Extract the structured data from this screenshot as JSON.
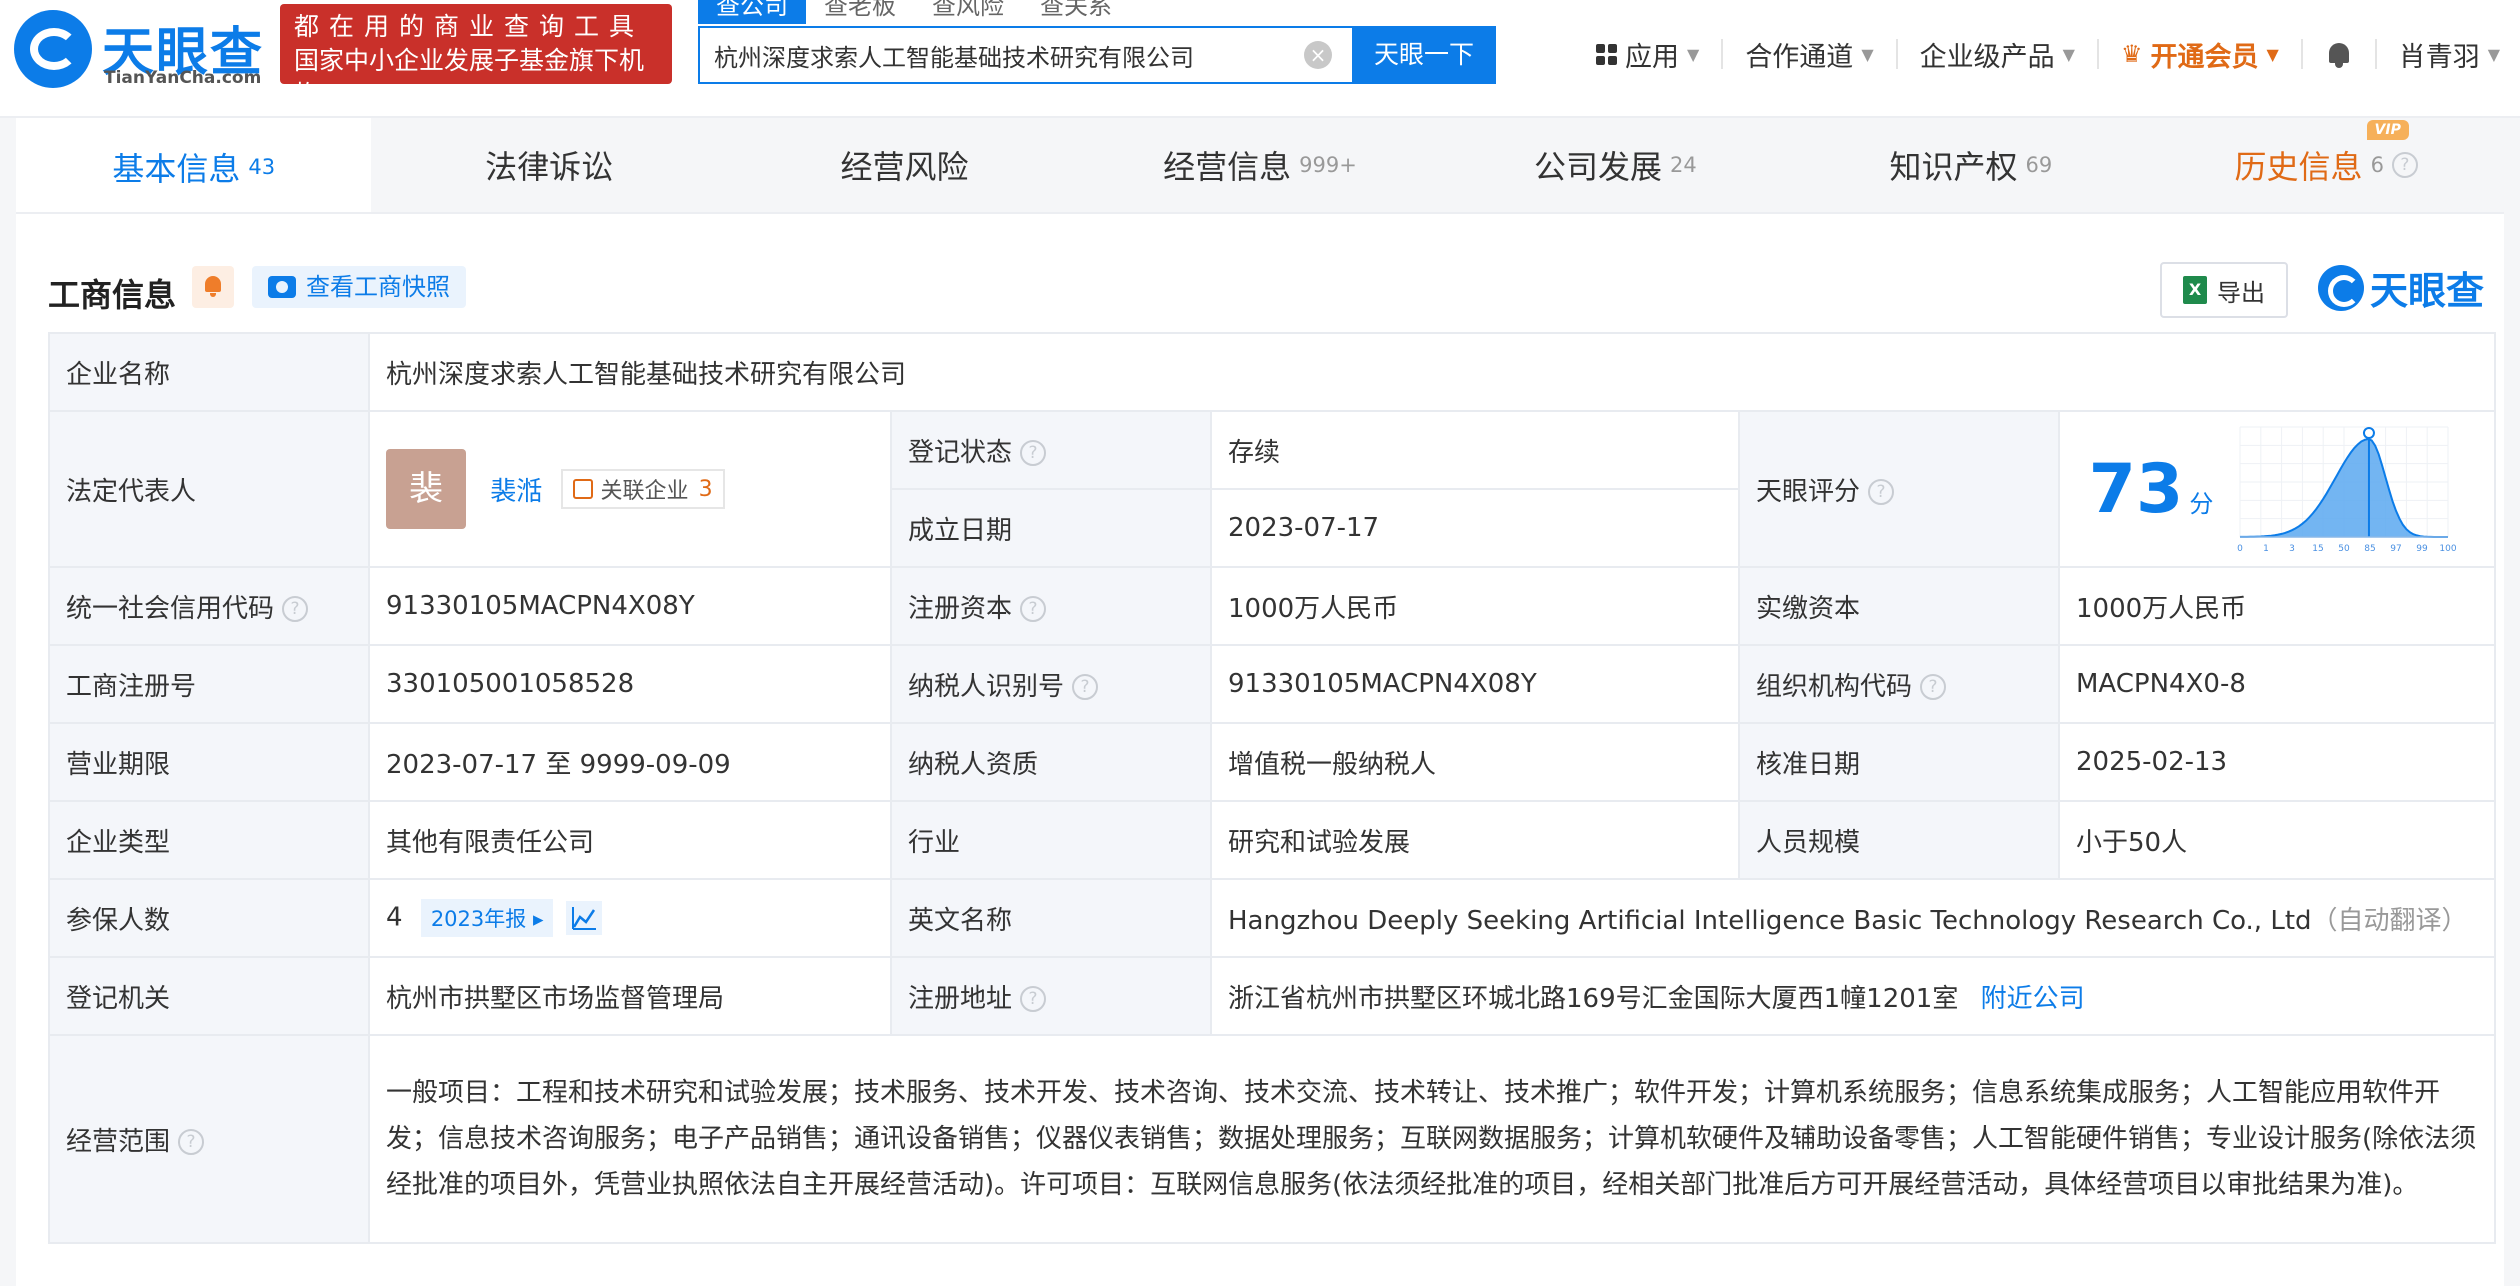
{
  "brand": {
    "name": "天眼查",
    "domain": "TianYanCha.com",
    "ad_line1": "都在用的商业查询工具",
    "ad_line2": "国家中小企业发展子基金旗下机构"
  },
  "search": {
    "tabs": [
      "查公司",
      "查老板",
      "查风险",
      "查关系"
    ],
    "query": "杭州深度求索人工智能基础技术研究有限公司",
    "button": "天眼一下"
  },
  "nav": {
    "apps": "应用",
    "partner": "合作通道",
    "enterprise": "企业级产品",
    "vip": "开通会员",
    "user": "肖青羽"
  },
  "tabs": [
    {
      "label": "基本信息",
      "count": "43"
    },
    {
      "label": "法律诉讼",
      "count": ""
    },
    {
      "label": "经营风险",
      "count": ""
    },
    {
      "label": "经营信息",
      "count": "999+"
    },
    {
      "label": "公司发展",
      "count": "24"
    },
    {
      "label": "知识产权",
      "count": "69"
    },
    {
      "label": "历史信息",
      "count": "6",
      "badge": "VIP"
    }
  ],
  "section": {
    "title": "工商信息",
    "snapshot": "查看工商快照",
    "export": "导出",
    "brand_mark": "天眼查"
  },
  "info": {
    "company_name_label": "企业名称",
    "company_name": "杭州深度求索人工智能基础技术研究有限公司",
    "legal_rep_label": "法定代表人",
    "legal_rep_avatar": "裴",
    "legal_rep": "裴湉",
    "related_label": "关联企业",
    "related_count": "3",
    "status_label": "登记状态",
    "status": "存续",
    "founded_label": "成立日期",
    "founded": "2023-07-17",
    "score_label": "天眼评分",
    "score": "73",
    "score_unit": "分",
    "credit_code_label": "统一社会信用代码",
    "credit_code": "91330105MACPN4X08Y",
    "reg_capital_label": "注册资本",
    "reg_capital": "1000万人民币",
    "paid_capital_label": "实缴资本",
    "paid_capital": "1000万人民币",
    "reg_no_label": "工商注册号",
    "reg_no": "330105001058528",
    "taxpayer_id_label": "纳税人识别号",
    "taxpayer_id": "91330105MACPN4X08Y",
    "org_code_label": "组织机构代码",
    "org_code": "MACPN4X0-8",
    "term_label": "营业期限",
    "term": "2023-07-17 至 9999-09-09",
    "taxpayer_qual_label": "纳税人资质",
    "taxpayer_qual": "增值税一般纳税人",
    "approval_date_label": "核准日期",
    "approval_date": "2025-02-13",
    "company_type_label": "企业类型",
    "company_type": "其他有限责任公司",
    "industry_label": "行业",
    "industry": "研究和试验发展",
    "staff_size_label": "人员规模",
    "staff_size": "小于50人",
    "insured_label": "参保人数",
    "insured": "4",
    "insured_report": "2023年报",
    "english_name_label": "英文名称",
    "english_name": "Hangzhou Deeply Seeking Artificial Intelligence Basic Technology Research Co., Ltd",
    "english_name_note": "（自动翻译）",
    "authority_label": "登记机关",
    "authority": "杭州市拱墅区市场监督管理局",
    "address_label": "注册地址",
    "address": "浙江省杭州市拱墅区环城北路169号汇金国际大厦西1幢1201室",
    "nearby": "附近公司",
    "scope_label": "经营范围",
    "scope": "一般项目：工程和技术研究和试验发展；技术服务、技术开发、技术咨询、技术交流、技术转让、技术推广；软件开发；计算机系统服务；信息系统集成服务；人工智能应用软件开发；信息技术咨询服务；电子产品销售；通讯设备销售；仪器仪表销售；数据处理服务；互联网数据服务；计算机软硬件及辅助设备零售；人工智能硬件销售；专业设计服务(除依法须经批准的项目外，凭营业执照依法自主开展经营活动)。许可项目：互联网信息服务(依法须经批准的项目，经相关部门批准后方可开展经营活动，具体经营项目以审批结果为准)。"
  },
  "score_chart": {
    "ticks": [
      "0",
      "1",
      "3",
      "15",
      "50",
      "85",
      "97",
      "99",
      "100"
    ],
    "marker_value": 73
  },
  "colors": {
    "accent": "#0c7ce8",
    "vip": "#e06a16",
    "status_green": "#2e9c47",
    "ad_red": "#c9302a"
  }
}
